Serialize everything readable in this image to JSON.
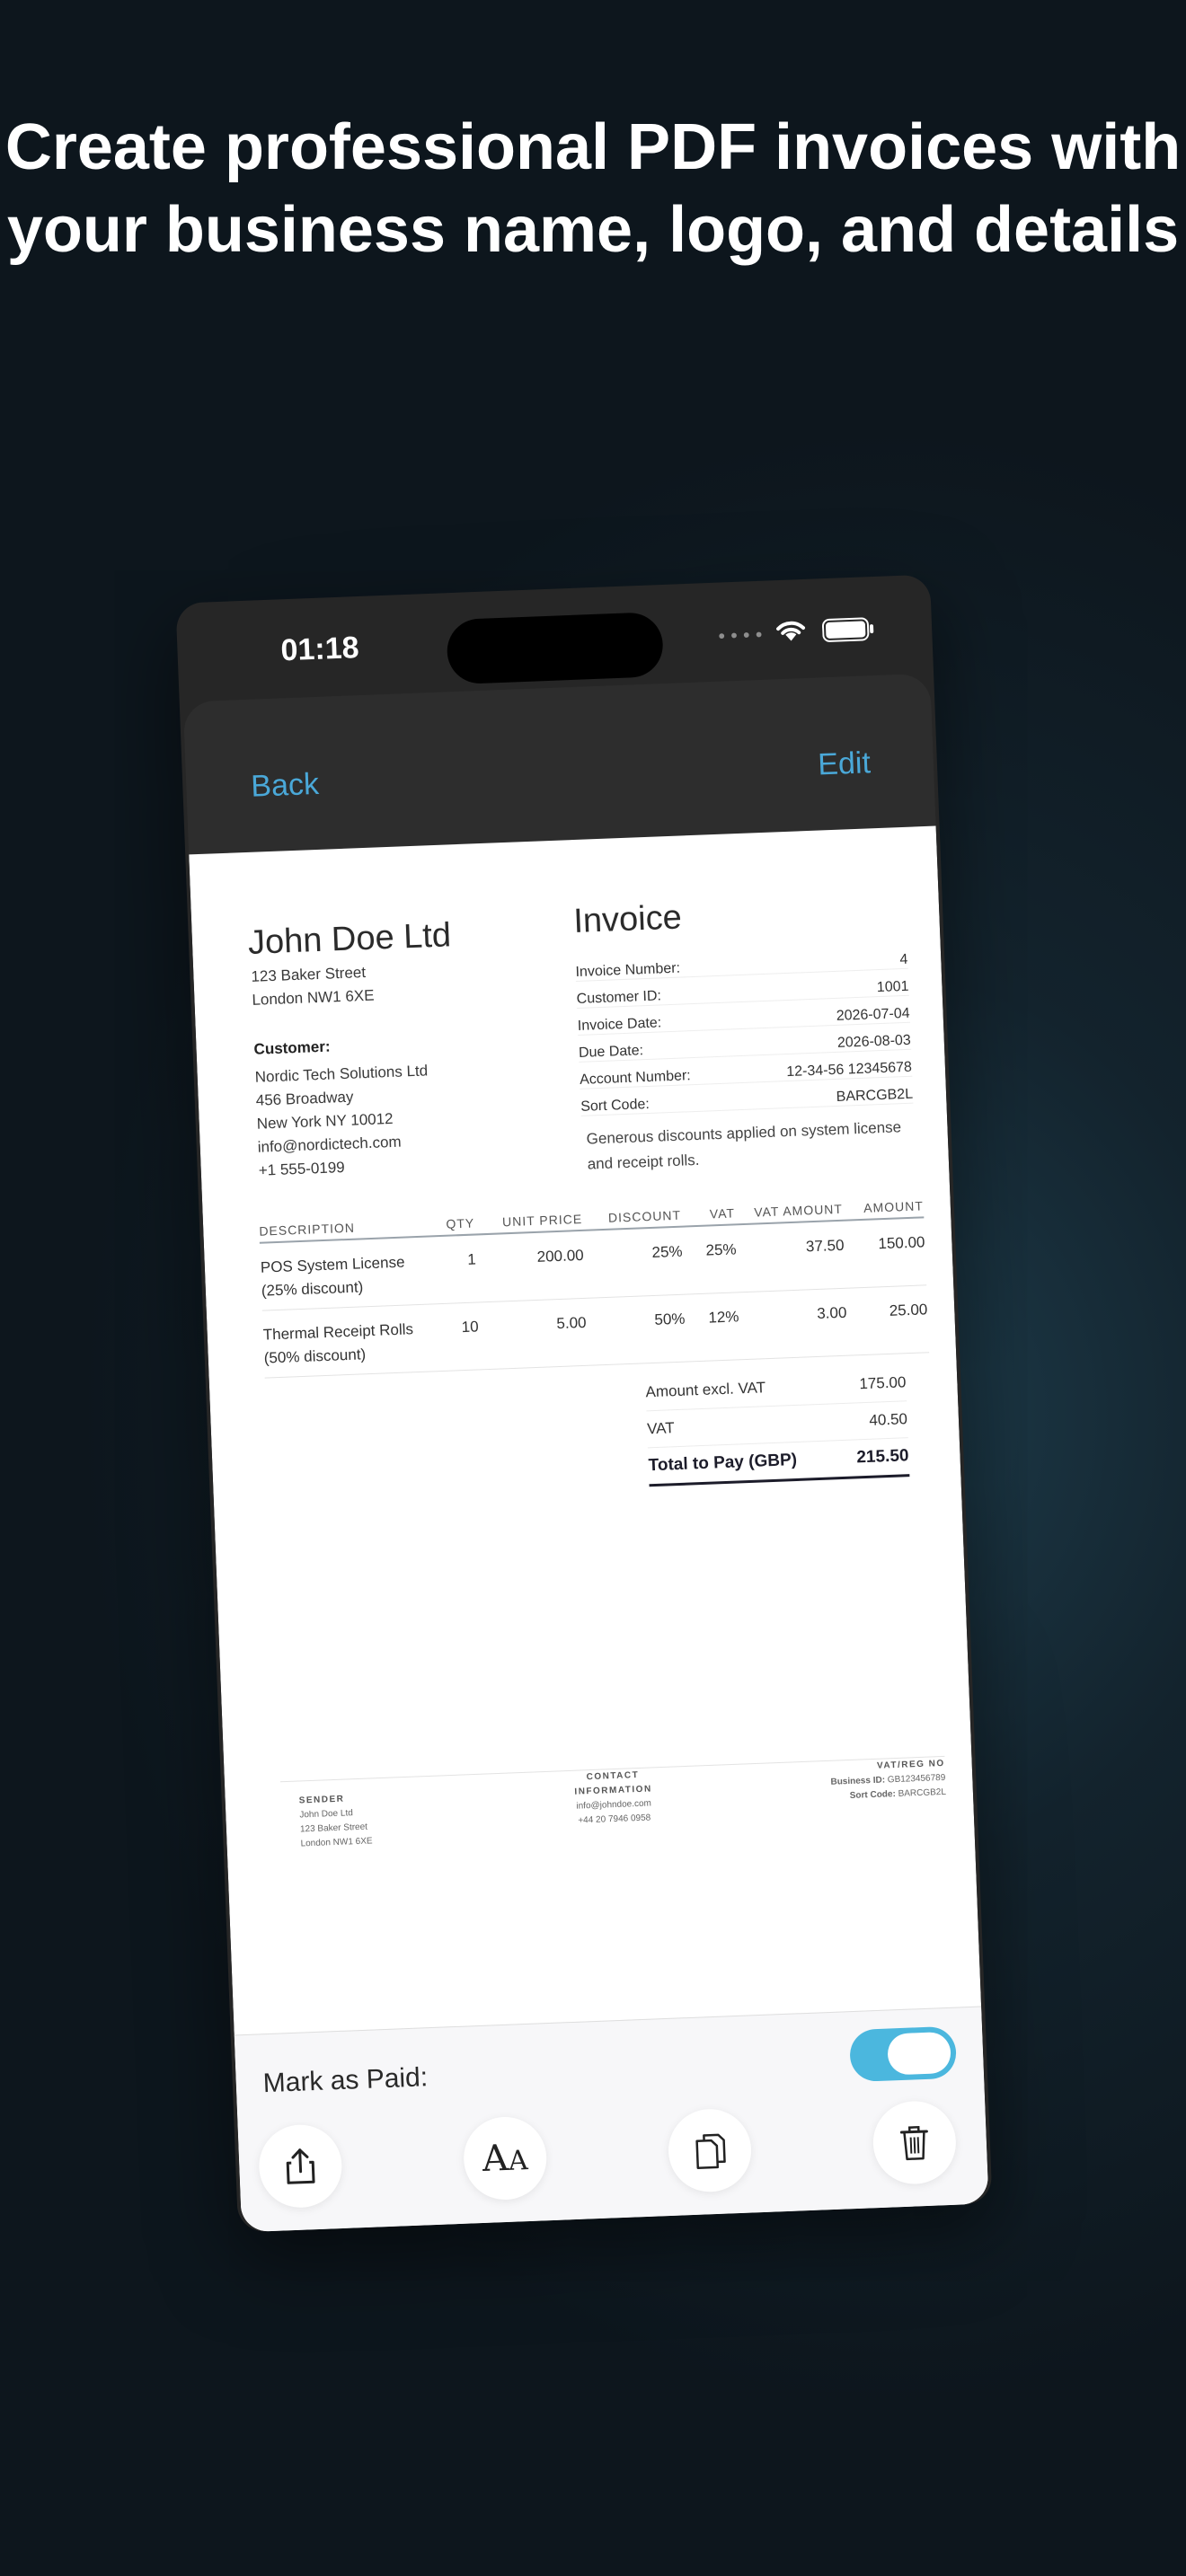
{
  "headline": {
    "line1": "Create professional PDF invoices with",
    "line2": "your business name, logo, and details"
  },
  "status": {
    "time": "01:18",
    "dots": "••••"
  },
  "nav": {
    "back": "Back",
    "edit": "Edit"
  },
  "business": {
    "name": "John Doe Ltd",
    "address": [
      "123 Baker Street",
      "London NW1 6XE"
    ]
  },
  "customer": {
    "label": "Customer:",
    "lines": [
      "Nordic Tech Solutions Ltd",
      "456 Broadway",
      "New York NY 10012",
      "info@nordictech.com",
      "+1 555-0199"
    ]
  },
  "invoice": {
    "title": "Invoice",
    "meta": [
      {
        "label": "Invoice Number:",
        "value": "4"
      },
      {
        "label": "Customer ID:",
        "value": "1001"
      },
      {
        "label": "Invoice Date:",
        "value": "2026-07-04"
      },
      {
        "label": "Due Date:",
        "value": "2026-08-03"
      },
      {
        "label": "Account Number:",
        "value": "12-34-56 12345678"
      },
      {
        "label": "Sort Code:",
        "value": "BARCGB2L"
      }
    ],
    "note": "Generous discounts applied on system license and receipt rolls."
  },
  "items": {
    "headers": [
      "DESCRIPTION",
      "QTY",
      "UNIT PRICE",
      "DISCOUNT",
      "VAT",
      "VAT AMOUNT",
      "AMOUNT"
    ],
    "rows": [
      {
        "desc1": "POS System License",
        "desc2": "(25% discount)",
        "qty": "1",
        "unit_price": "200.00",
        "discount": "25%",
        "vat": "25%",
        "vat_amount": "37.50",
        "amount": "150.00"
      },
      {
        "desc1": "Thermal Receipt Rolls",
        "desc2": "(50% discount)",
        "qty": "10",
        "unit_price": "5.00",
        "discount": "50%",
        "vat": "12%",
        "vat_amount": "3.00",
        "amount": "25.00"
      }
    ]
  },
  "totals": {
    "excl_label": "Amount excl. VAT",
    "excl_value": "175.00",
    "vat_label": "VAT",
    "vat_value": "40.50",
    "total_label": "Total to Pay (GBP)",
    "total_value": "215.50"
  },
  "footer": {
    "sender_h": "SENDER",
    "sender": [
      "John Doe Ltd",
      "123 Baker Street",
      "London NW1 6XE"
    ],
    "contact_h": "CONTACT INFORMATION",
    "contact": [
      "info@johndoe.com",
      "+44 20 7946 0958"
    ],
    "vat_h": "VAT/REG NO",
    "business_id_label": "Business ID:",
    "business_id": "GB123456789",
    "sort_code_label": "Sort Code:",
    "sort_code": "BARCGB2L"
  },
  "bottom": {
    "paid_label": "Mark as Paid:",
    "paid": true
  },
  "icons": [
    "share-icon",
    "font-size-icon",
    "duplicate-icon",
    "trash-icon"
  ],
  "colors": {
    "accent": "#4aa8d8",
    "toggle": "#4bb7de"
  }
}
